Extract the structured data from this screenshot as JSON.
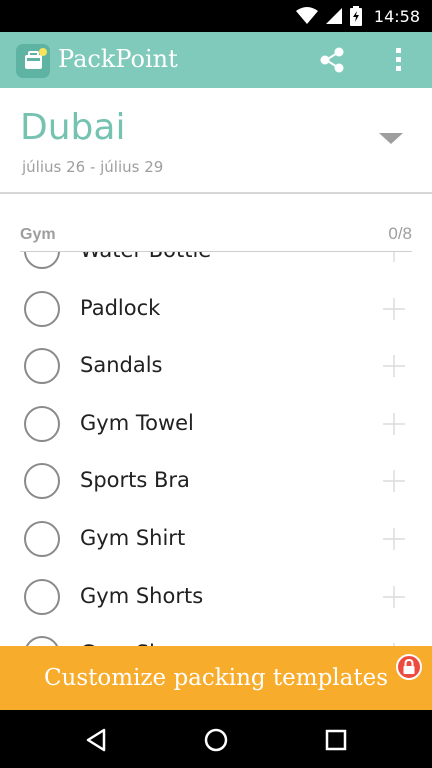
{
  "status_bar": {
    "time": "14:58",
    "icons": [
      "wifi-icon",
      "cellular-icon",
      "battery-charging-icon"
    ]
  },
  "app_bar": {
    "title": "PackPoint",
    "logo_icon": "suitcase-icon",
    "actions": [
      "share-icon",
      "more-vertical-icon"
    ]
  },
  "trip": {
    "city": "Dubai",
    "dates": "július 26 - július 29",
    "dropdown_icon": "triangle-down-icon"
  },
  "section": {
    "title": "Gym",
    "count": "0/8"
  },
  "items": [
    {
      "label": "Water Bottle",
      "checked": false
    },
    {
      "label": "Padlock",
      "checked": false
    },
    {
      "label": "Sandals",
      "checked": false
    },
    {
      "label": "Gym Towel",
      "checked": false
    },
    {
      "label": "Sports Bra",
      "checked": false
    },
    {
      "label": "Gym Shirt",
      "checked": false
    },
    {
      "label": "Gym Shorts",
      "checked": false
    },
    {
      "label": "Gym Shoes",
      "checked": false
    }
  ],
  "banner": {
    "text": "Customize packing templates",
    "badge_icon": "lock-icon"
  },
  "nav_bar": {
    "buttons": [
      "back-icon",
      "home-icon",
      "recents-icon"
    ]
  },
  "colors": {
    "app_bar": "#7fcaba",
    "accent_text": "#76c2b1",
    "banner": "#f8ac2c",
    "lock_badge": "#ef4a3e"
  }
}
